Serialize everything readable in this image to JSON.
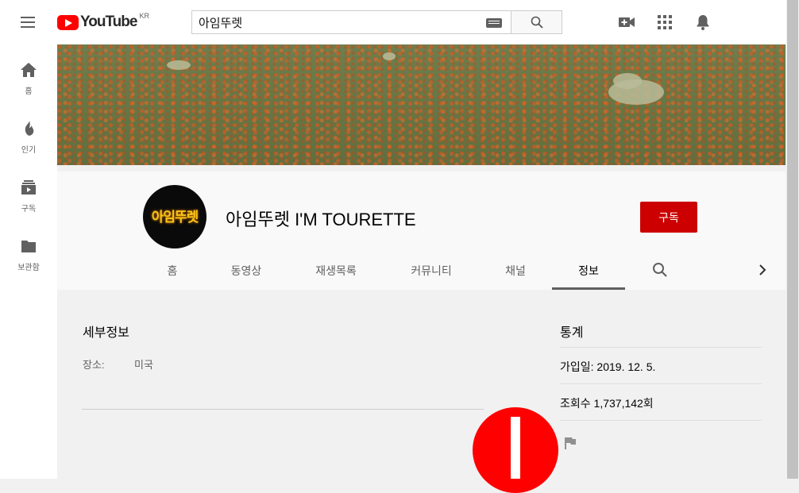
{
  "masthead": {
    "logo_text": "YouTube",
    "region": "KR",
    "search_value": "아임뚜렛",
    "icons": [
      "menu-icon",
      "keyboard-icon",
      "search-icon",
      "create-video-icon",
      "apps-icon",
      "notifications-icon"
    ]
  },
  "sidebar": {
    "items": [
      {
        "label": "홈",
        "icon": "home-icon"
      },
      {
        "label": "인기",
        "icon": "trending-icon"
      },
      {
        "label": "구독",
        "icon": "subscriptions-icon"
      },
      {
        "label": "보관함",
        "icon": "library-icon"
      }
    ]
  },
  "channel": {
    "avatar_text": "아임뚜렛",
    "name": "아임뚜렛 I'M TOURETTE",
    "subscribe_label": "구독"
  },
  "tabs": [
    {
      "label": "홈"
    },
    {
      "label": "동영상"
    },
    {
      "label": "재생목록"
    },
    {
      "label": "커뮤니티"
    },
    {
      "label": "채널"
    },
    {
      "label": "정보",
      "active": true
    }
  ],
  "about": {
    "details_title": "세부정보",
    "location_label": "장소:",
    "location_value": "미국",
    "stats_title": "통계",
    "joined": "가입일: 2019. 12. 5.",
    "views": "조회수 1,737,142회"
  },
  "colors": {
    "brand_red": "#ff0000",
    "subscribe_red": "#cc0000"
  }
}
